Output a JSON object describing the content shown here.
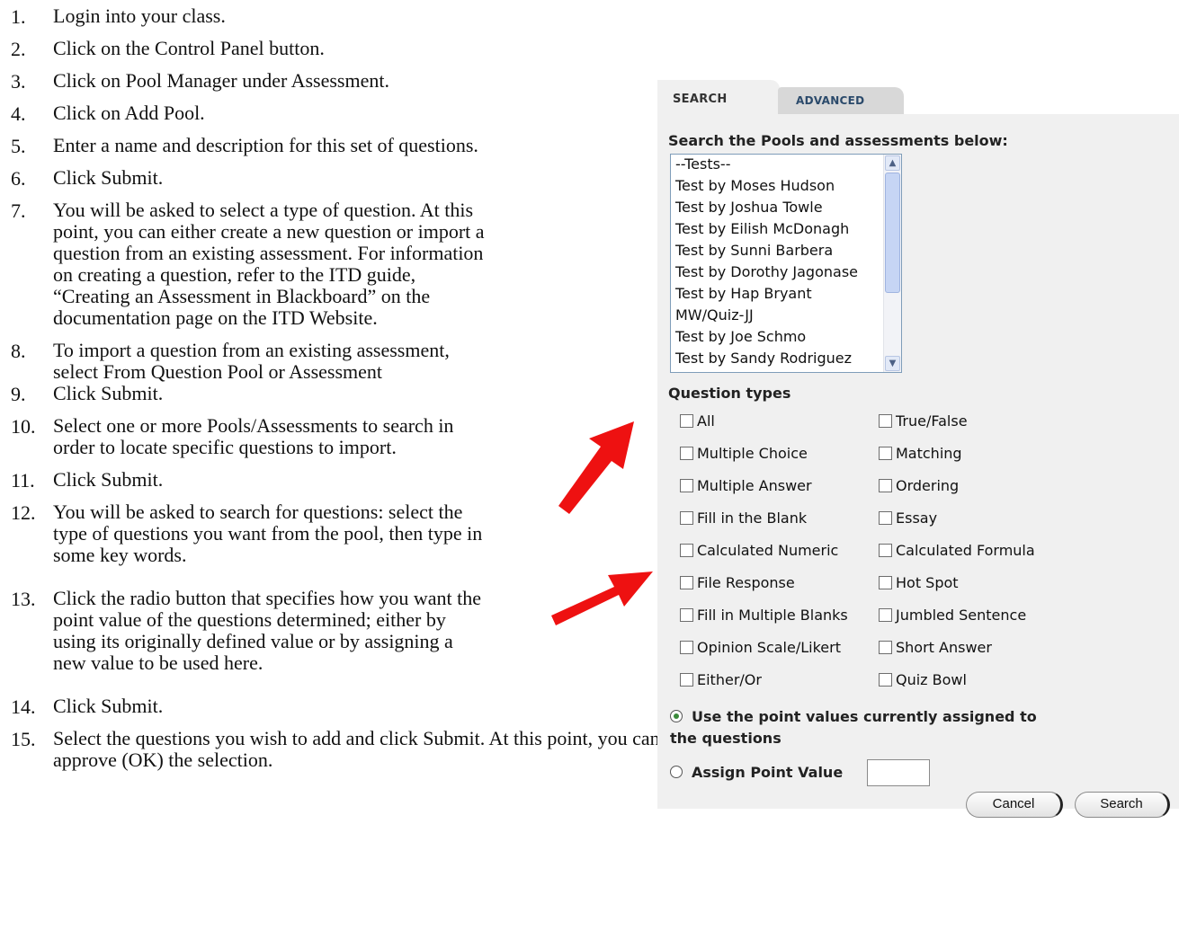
{
  "steps": [
    {
      "num": "1.",
      "lines": [
        "Login into your class."
      ]
    },
    {
      "num": "2.",
      "lines": [
        "Click on the Control Panel button."
      ]
    },
    {
      "num": "3.",
      "lines": [
        "Click on Pool Manager under Assessment."
      ]
    },
    {
      "num": "4.",
      "lines": [
        "Click on Add Pool."
      ]
    },
    {
      "num": "5.",
      "lines": [
        "Enter a name and description for this set of questions."
      ]
    },
    {
      "num": "6.",
      "lines": [
        "Click Submit."
      ]
    },
    {
      "num": "7.",
      "lines": [
        "You will be asked to select a type of question. At this",
        "point, you can either create a new question or import a",
        "question from an existing assessment. For information",
        "on creating a question, refer to the ITD guide,",
        "“Creating an Assessment in Blackboard” on the",
        "documentation page on the ITD Website."
      ]
    },
    {
      "num": "8.",
      "lines": [
        "To import a question from an existing assessment,",
        "select From Question Pool or Assessment"
      ]
    },
    {
      "num": "9.",
      "lines": [
        "Click Submit."
      ]
    },
    {
      "num": "10.",
      "lines": [
        "Select one or more Pools/Assessments to search in",
        "order to locate specific questions to import."
      ]
    },
    {
      "num": "11.",
      "lines": [
        "Click Submit."
      ]
    },
    {
      "num": "12.",
      "lines": [
        "You will be asked to search for questions: select the",
        "type of questions you want from the pool, then type in",
        "some key words."
      ]
    },
    {
      "num": "13.",
      "lines": [
        "Click the radio button that specifies how you want the",
        "point value of the questions determined; either by",
        "using its originally defined value or by assigning a",
        "new value to be used here."
      ]
    },
    {
      "num": "14.",
      "lines": [
        "Click Submit."
      ]
    },
    {
      "num": "15.",
      "lines": [
        "Select the questions you wish to add and click Submit. At this point, you can preview, modify, remove or",
        "approve (OK) the selection."
      ]
    }
  ],
  "panel": {
    "tabs": {
      "search": "SEARCH",
      "advanced": "ADVANCED"
    },
    "heading": "Search the Pools and assessments below:",
    "pools": [
      "--Tests--",
      "Test by Moses Hudson",
      "Test by Joshua Towle",
      "Test by Eilish McDonagh",
      "Test by Sunni Barbera",
      "Test by Dorothy Jagonase",
      "Test by Hap Bryant",
      "MW/Quiz-JJ",
      "Test by Joe Schmo",
      "Test by Sandy Rodriguez"
    ],
    "question_types_heading": "Question types",
    "question_types_left": [
      "All",
      "Multiple Choice",
      "Multiple Answer",
      "Fill in the Blank",
      "Calculated Numeric",
      "File Response",
      "Fill in Multiple Blanks",
      "Opinion Scale/Likert",
      "Either/Or"
    ],
    "question_types_right": [
      "True/False",
      "Matching",
      "Ordering",
      "Essay",
      "Calculated Formula",
      "Hot Spot",
      "Jumbled Sentence",
      "Short Answer",
      "Quiz Bowl"
    ],
    "radio_use_current_line1": "Use the point values currently assigned to",
    "radio_use_current_line2": "the questions",
    "radio_assign": "Assign Point Value",
    "point_value": "",
    "cancel_label": "Cancel",
    "search_label": "Search"
  },
  "colors": {
    "arrow": "#ee1111",
    "panel_bg": "#f0f0f0",
    "tab_text": "#2b4a6b"
  }
}
